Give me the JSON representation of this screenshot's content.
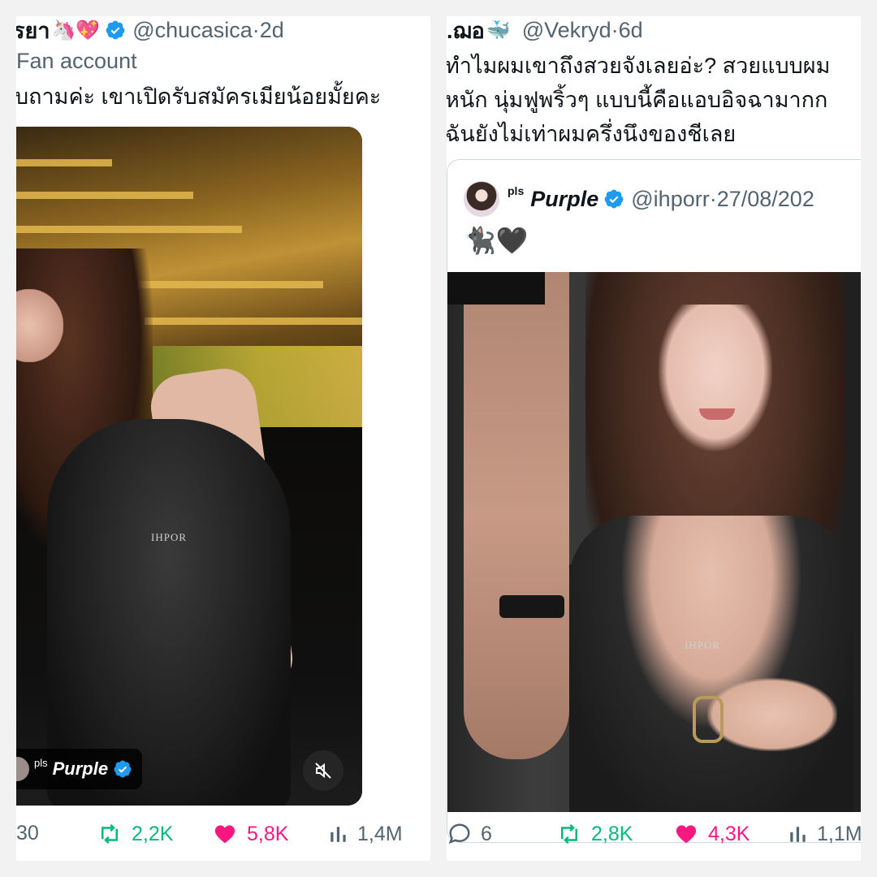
{
  "left_tweet": {
    "display_name": "รยา",
    "emoji": "🦄💖",
    "handle": "@chucasica",
    "time": "2d",
    "subtitle": "Fan account",
    "text": "บถามค่ะ เขาเปิดรับสมัครเมียน้อยมั้ยคะ",
    "media": {
      "watermark": "IHPOR",
      "source_pls": "pls",
      "source_name": "Purple"
    },
    "stats": {
      "replies": "30",
      "retweets": "2,2K",
      "likes": "5,8K",
      "views": "1,4M"
    }
  },
  "right_tweet": {
    "display_name": ".ฌอ",
    "emoji": "🐳",
    "handle": "@Vekryd",
    "time": "6d",
    "text_lines": [
      "ทำไมผมเขาถึงสวยจังเลยอ่ะ? สวยแบบผม",
      "หนัก นุ่มฟูพริ้วๆ แบบนี้คือแอบอิจฉามากก",
      "ฉันยังไม่เท่าผมครึ่งนึงของชีเลย"
    ],
    "quote": {
      "pls": "pls",
      "name": "Purple",
      "handle": "@ihporr",
      "date": "27/08/202",
      "emoji": "🐈‍⬛🖤",
      "watermark": "IHPOR"
    },
    "stats": {
      "replies": "6",
      "retweets": "2,8K",
      "likes": "4,3K",
      "views": "1,1M"
    }
  },
  "colors": {
    "verified": "#1d9bf0",
    "retweet": "#00ba7c",
    "like": "#f91880",
    "muted": "#536471",
    "text": "#0f1419"
  }
}
